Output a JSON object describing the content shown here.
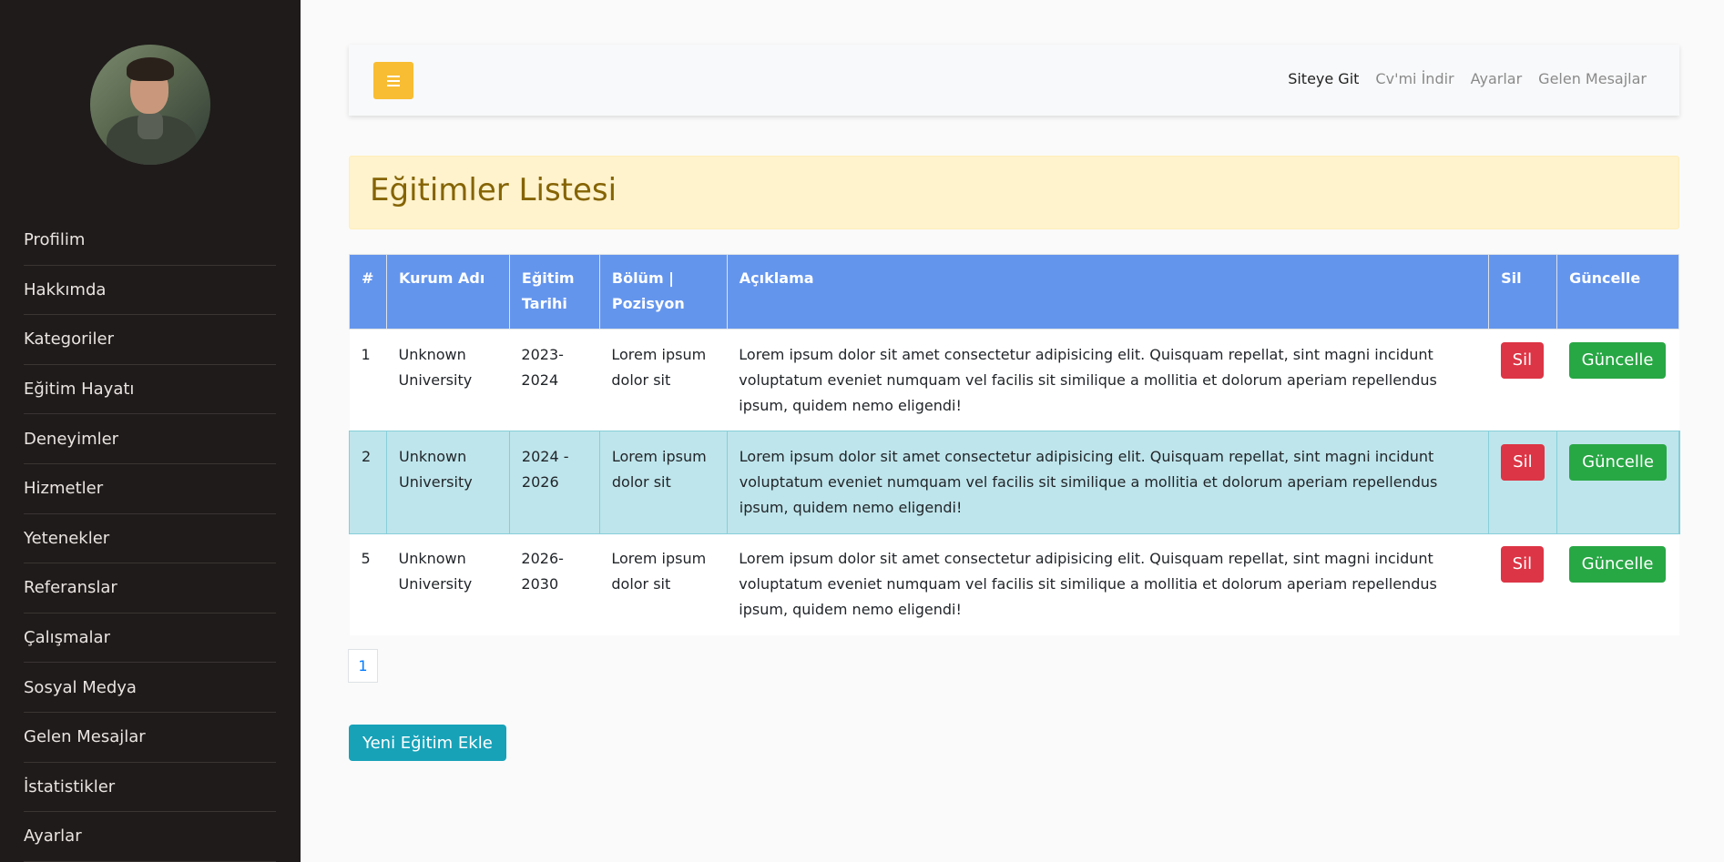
{
  "sidebar": {
    "items": [
      {
        "label": "Profilim"
      },
      {
        "label": "Hakkımda"
      },
      {
        "label": "Kategoriler"
      },
      {
        "label": "Eğitim Hayatı"
      },
      {
        "label": "Deneyimler"
      },
      {
        "label": "Hizmetler"
      },
      {
        "label": "Yetenekler"
      },
      {
        "label": "Referanslar"
      },
      {
        "label": "Çalışmalar"
      },
      {
        "label": "Sosyal Medya"
      },
      {
        "label": "Gelen Mesajlar"
      },
      {
        "label": "İstatistikler"
      },
      {
        "label": "Ayarlar"
      }
    ]
  },
  "topbar": {
    "links": [
      {
        "label": "Siteye Git"
      },
      {
        "label": "Cv'mi İndir"
      },
      {
        "label": "Ayarlar"
      },
      {
        "label": "Gelen Mesajlar"
      }
    ],
    "colors": {
      "toggle": "#f8bd33"
    }
  },
  "page": {
    "title": "Eğitimler Listesi"
  },
  "table": {
    "headers": {
      "num": "#",
      "kurum": "Kurum Adı",
      "tarih": "Eğitim Tarihi",
      "bolum": "Bölüm | Pozisyon",
      "aciklama": "Açıklama",
      "sil": "Sil",
      "guncelle": "Güncelle"
    },
    "rows": [
      {
        "num": "1",
        "kurum": "Unknown University",
        "tarih": "2023-2024",
        "bolum": "Lorem ipsum dolor sit",
        "aciklama": "Lorem ipsum dolor sit amet consectetur adipisicing elit. Quisquam repellat, sint magni incidunt voluptatum eveniet numquam vel facilis sit similique a mollitia et dolorum aperiam repellendus ipsum, quidem nemo eligendi!",
        "sil": "Sil",
        "guncelle": "Güncelle"
      },
      {
        "num": "2",
        "kurum": "Unknown University",
        "tarih": "2024 - 2026",
        "bolum": "Lorem ipsum dolor sit",
        "aciklama": "Lorem ipsum dolor sit amet consectetur adipisicing elit. Quisquam repellat, sint magni incidunt voluptatum eveniet numquam vel facilis sit similique a mollitia et dolorum aperiam repellendus ipsum, quidem nemo eligendi!",
        "sil": "Sil",
        "guncelle": "Güncelle"
      },
      {
        "num": "5",
        "kurum": "Unknown University",
        "tarih": "2026-2030",
        "bolum": "Lorem ipsum dolor sit",
        "aciklama": "Lorem ipsum dolor sit amet consectetur adipisicing elit. Quisquam repellat, sint magni incidunt voluptatum eveniet numquam vel facilis sit similique a mollitia et dolorum aperiam repellendus ipsum, quidem nemo eligendi!",
        "sil": "Sil",
        "guncelle": "Güncelle"
      }
    ],
    "colors": {
      "header": "#6495ed",
      "highlight": "#bee5eb",
      "delete": "#dc3545",
      "update": "#28a745"
    }
  },
  "pagination": {
    "current": "1"
  },
  "actions": {
    "add_label": "Yeni Eğitim Ekle"
  }
}
